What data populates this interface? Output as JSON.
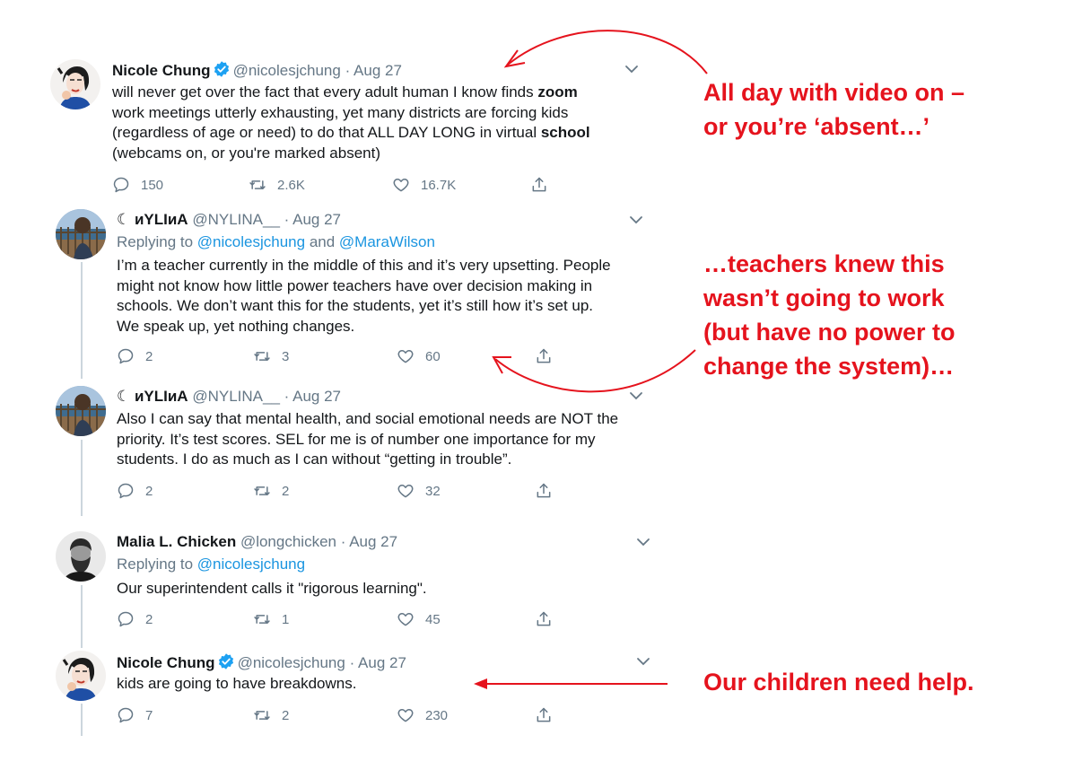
{
  "tweets": [
    {
      "name": "Nicole Chung",
      "verified": true,
      "handle": "@nicolesjchung",
      "dot": "·",
      "date": "Aug 27",
      "replying_label": "",
      "replying_to": [],
      "text_html": "will never get over the fact that every adult human I know finds <b>zoom</b><br>work meetings utterly exhausting, yet many districts are forcing kids<br>(regardless of age or need) to do that ALL DAY LONG in virtual <b>school</b><br>(webcams on, or you're marked absent)",
      "replies": "150",
      "retweets": "2.6K",
      "likes": "16.7K",
      "avatar": "nicole-avatar"
    },
    {
      "name": "☾ иYLIиA",
      "verified": false,
      "handle": "@NYLINA__",
      "dot": "·",
      "date": "Aug 27",
      "replying_label": "Replying to",
      "replying_to": [
        "@nicolesjchung",
        "and",
        "@MaraWilson"
      ],
      "text_html": "I’m a teacher currently in the middle of this and it’s very upsetting. People<br>might not know how little power teachers have over decision making in<br>schools. We don’t want this for the students, yet it’s still how it’s set up.<br>We speak up, yet nothing changes.",
      "replies": "2",
      "retweets": "3",
      "likes": "60",
      "avatar": "beach-avatar"
    },
    {
      "name": "☾ иYLIиA",
      "verified": false,
      "handle": "@NYLINA__",
      "dot": "·",
      "date": "Aug 27",
      "replying_label": "",
      "replying_to": [],
      "text_html": "Also I can say that mental health, and social emotional needs are NOT the<br>priority. It’s test scores. SEL for me is of number one importance for my<br>students. I do as much as I can without “getting in trouble”.",
      "replies": "2",
      "retweets": "2",
      "likes": "32",
      "avatar": "beach-avatar"
    },
    {
      "name": "Malia L. Chicken",
      "verified": false,
      "handle": "@longchicken",
      "dot": "·",
      "date": "Aug 27",
      "replying_label": "Replying to",
      "replying_to": [
        "@nicolesjchung"
      ],
      "text_html": "Our superintendent calls it \"rigorous learning\".",
      "replies": "2",
      "retweets": "1",
      "likes": "45",
      "avatar": "bearded-avatar"
    },
    {
      "name": "Nicole Chung",
      "verified": true,
      "handle": "@nicolesjchung",
      "dot": "·",
      "date": "Aug 27",
      "replying_label": "",
      "replying_to": [],
      "text_html": "kids are going to have breakdowns.",
      "replies": "7",
      "retweets": "2",
      "likes": "230",
      "avatar": "nicole-avatar"
    }
  ],
  "annotations": [
    {
      "lines": [
        "All day with video on –",
        "or you’re ‘absent…’"
      ]
    },
    {
      "lines": [
        "…teachers knew this",
        "wasn’t going to work",
        "(but have no power to",
        "change the system)…"
      ]
    },
    {
      "lines": [
        "Our children need help."
      ]
    }
  ],
  "colors": {
    "annotation": "#e5131d",
    "link": "#1b95e0",
    "muted": "#657786",
    "verified": "#1da1f2",
    "thread": "#ccd6dd"
  },
  "icons": [
    "verified-badge-icon",
    "chevron-down-icon",
    "reply-icon",
    "retweet-icon",
    "like-icon",
    "share-icon"
  ]
}
